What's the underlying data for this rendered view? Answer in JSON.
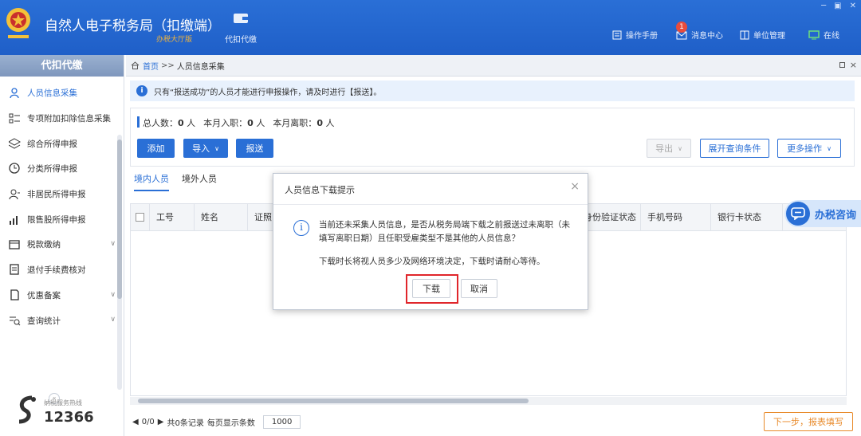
{
  "app": {
    "title": "自然人电子税务局（扣缴端）",
    "subtitle": "办税大厅版",
    "module": "代扣代缴",
    "menu": {
      "manual": "操作手册",
      "messages": "消息中心",
      "message_count": "1",
      "unit": "单位管理",
      "status": "在线"
    },
    "window_controls": [
      "─",
      "▣",
      "✕"
    ]
  },
  "sidebar": {
    "header": "代扣代缴",
    "items": [
      {
        "label": "人员信息采集",
        "icon": "person-icon",
        "active": true
      },
      {
        "label": "专项附加扣除信息采集",
        "icon": "list-icon"
      },
      {
        "label": "综合所得申报",
        "icon": "layers-icon"
      },
      {
        "label": "分类所得申报",
        "icon": "clock-icon"
      },
      {
        "label": "非居民所得申报",
        "icon": "user-globe-icon"
      },
      {
        "label": "限售股所得申报",
        "icon": "bar-chart-icon"
      },
      {
        "label": "税款缴纳",
        "icon": "folder-icon",
        "expand": true
      },
      {
        "label": "退付手续费核对",
        "icon": "receipt-icon"
      },
      {
        "label": "优惠备案",
        "icon": "document-icon",
        "expand": true
      },
      {
        "label": "查询统计",
        "icon": "query-icon",
        "expand": true
      }
    ],
    "collapse": "«",
    "hotline_label": "纳税服务热线",
    "hotline": "12366"
  },
  "breadcrumb": {
    "home": "首页",
    "sep": ">>",
    "current": "人员信息采集",
    "close": "×"
  },
  "notice": {
    "icon": "i",
    "text": "只有“报送成功”的人员才能进行申报操作，请及时进行【报送】。"
  },
  "stats": {
    "total_label": "总人数：",
    "total_value": "0",
    "total_unit": "人",
    "joined_label": "本月入职：",
    "joined_value": "0",
    "joined_unit": "人",
    "left_label": "本月离职：",
    "left_value": "0",
    "left_unit": "人"
  },
  "toolbar": {
    "add": "添加",
    "import": "导入",
    "submit": "报送",
    "export": "导出",
    "expand_query": "展开查询条件",
    "more": "更多操作"
  },
  "tabs": [
    "境内人员",
    "境外人员"
  ],
  "table": {
    "columns": [
      "工号",
      "姓名",
      "证照",
      "身份验证状态",
      "手机号码",
      "银行卡状态"
    ]
  },
  "pager": {
    "text": "0/0",
    "records": "共0条记录",
    "per_page_label": "每页显示条数",
    "per_page": "1000"
  },
  "next_button": "下一步，报表填写",
  "chat": {
    "label": "办税咨询"
  },
  "dialog": {
    "title": "人员信息下载提示",
    "close": "×",
    "message": "当前还未采集人员信息，是否从税务局端下载之前报送过未离职（未填写离职日期）且任职受雇类型不是其他的人员信息？",
    "note": "下载时长将视人员多少及网络环境决定，下载时请耐心等待。",
    "confirm": "下载",
    "cancel": "取消"
  },
  "colors": {
    "primary": "#2a6fd6",
    "accent_orange": "#e88a2a",
    "highlight_red": "#e0262b"
  }
}
